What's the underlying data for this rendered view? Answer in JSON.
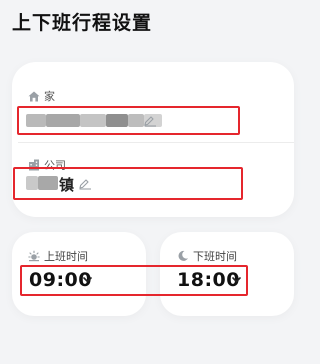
{
  "page": {
    "title": "上下班行程设置"
  },
  "home": {
    "label": "家",
    "icon": "home-icon",
    "value_obscured": true
  },
  "company": {
    "label": "公司",
    "icon": "building-icon",
    "value_suffix": "镇"
  },
  "commute": {
    "start": {
      "label": "上班时间",
      "icon": "sun-icon",
      "value": "09:00"
    },
    "end": {
      "label": "下班时间",
      "icon": "moon-icon",
      "value": "18:00"
    }
  },
  "colors": {
    "highlight_border": "#e5262d",
    "background": "#f3f4f6",
    "card": "#ffffff"
  }
}
